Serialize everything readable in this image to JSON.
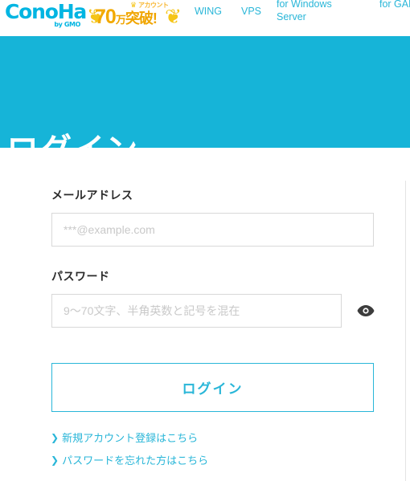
{
  "header": {
    "logo": {
      "name": "ConoHa",
      "sub": "by GMO",
      "color": "#00b5e2"
    },
    "badge": {
      "small_label": "アカウント",
      "number": "70",
      "unit": "万",
      "kanji": "突破!",
      "color": "#f0a500"
    },
    "nav": {
      "wing": "WING",
      "vps": "VPS",
      "windows": "for Windows Server",
      "game": "for GAME"
    }
  },
  "hero": {
    "title": "ログイン",
    "bg_color": "#16b4d8"
  },
  "form": {
    "email": {
      "label": "メールアドレス",
      "placeholder": "***@example.com",
      "value": ""
    },
    "password": {
      "label": "パスワード",
      "placeholder": "9〜70文字、半角英数と記号を混在",
      "value": "",
      "toggle_icon": "eye-icon"
    },
    "submit_label": "ログイン",
    "submit_color": "#29b6d8",
    "links": {
      "signup": "新規アカウント登録はこちら",
      "forgot": "パスワードを忘れた方はこちら",
      "chevron": "❯"
    }
  }
}
